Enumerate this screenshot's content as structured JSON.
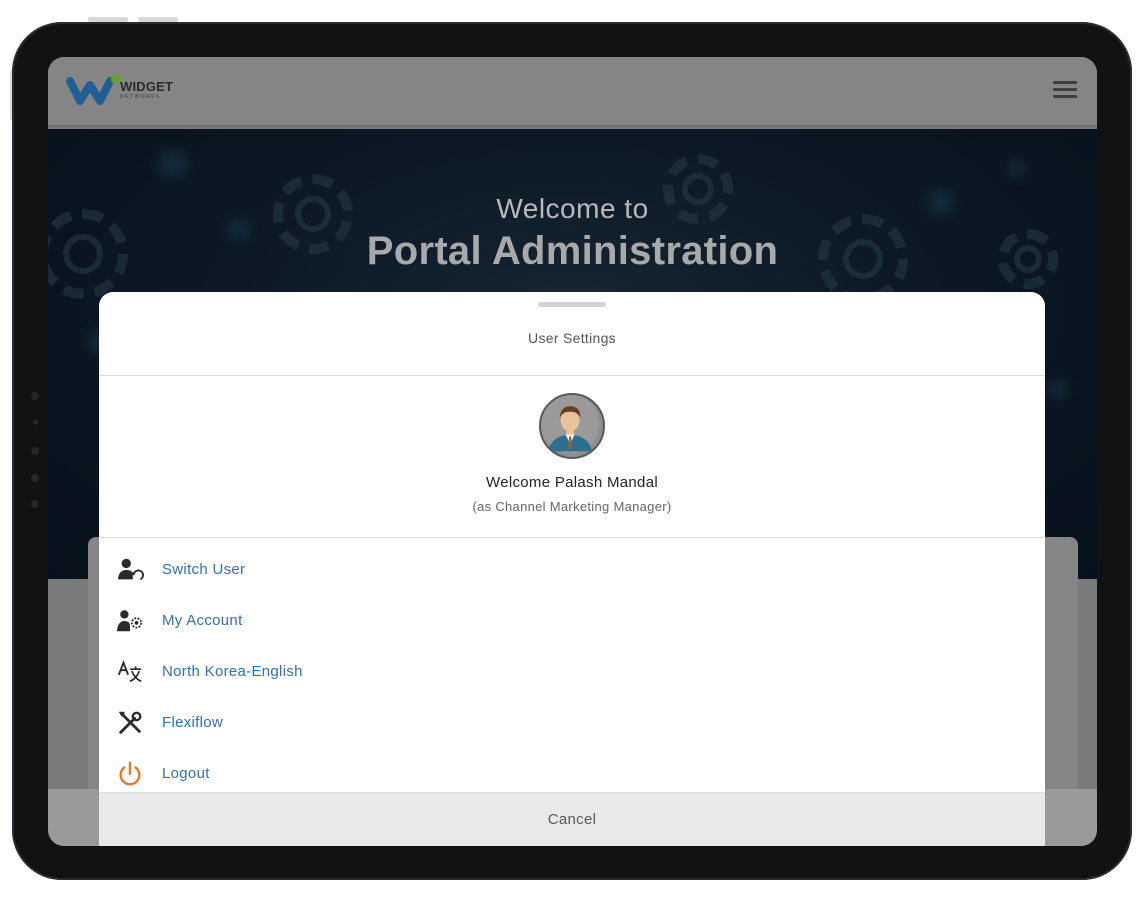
{
  "app": {
    "logo_text": "WIDGET",
    "logo_subtext": "NETWORKS",
    "logo_icon": "widget-logo-icon",
    "menu_icon": "hamburger-menu-icon"
  },
  "hero": {
    "line1": "Welcome to",
    "line2": "Portal Administration"
  },
  "user_settings": {
    "title": "User Settings",
    "avatar_icon": "user-avatar",
    "welcome": "Welcome Palash Mandal",
    "role": "(as Channel Marketing Manager)",
    "items": [
      {
        "label": "Switch User",
        "icon": "switch-user-icon"
      },
      {
        "label": "My Account",
        "icon": "account-settings-icon"
      },
      {
        "label": "North Korea-English",
        "icon": "translate-icon"
      },
      {
        "label": "Flexiflow",
        "icon": "tools-icon"
      },
      {
        "label": "Logout",
        "icon": "power-icon"
      }
    ],
    "cancel_label": "Cancel"
  },
  "colors": {
    "link": "#2f6fb3",
    "logout_icon": "#e8761e",
    "logo_blue": "#1f6fb5",
    "logo_green": "#7dbb2a"
  }
}
